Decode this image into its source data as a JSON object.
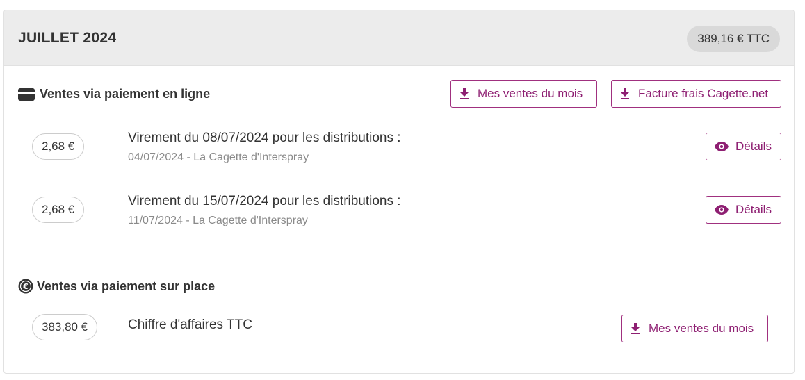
{
  "header": {
    "month": "JUILLET 2024",
    "total": "389,16 € TTC"
  },
  "online": {
    "title": "Ventes via paiement en ligne",
    "icon": "credit-card-icon",
    "sales_button": "Mes ventes du mois",
    "invoice_button": "Facture frais Cagette.net",
    "transfers": [
      {
        "amount": "2,68 €",
        "title": "Virement du 08/07/2024 pour les distributions :",
        "subtitle": "04/07/2024 - La Cagette d'Interspray",
        "details_button": "Détails"
      },
      {
        "amount": "2,68 €",
        "title": "Virement du 15/07/2024 pour les distributions :",
        "subtitle": "11/07/2024 - La Cagette d'Interspray",
        "details_button": "Détails"
      }
    ]
  },
  "onsite": {
    "title": "Ventes via paiement sur place",
    "icon": "euro-coin-icon",
    "amount": "383,80 €",
    "label": "Chiffre d'affaires TTC",
    "sales_button": "Mes ventes du mois"
  },
  "colors": {
    "accent": "#8e1f72",
    "header_bg": "#ececec",
    "badge_bg": "#d9d9d9"
  }
}
